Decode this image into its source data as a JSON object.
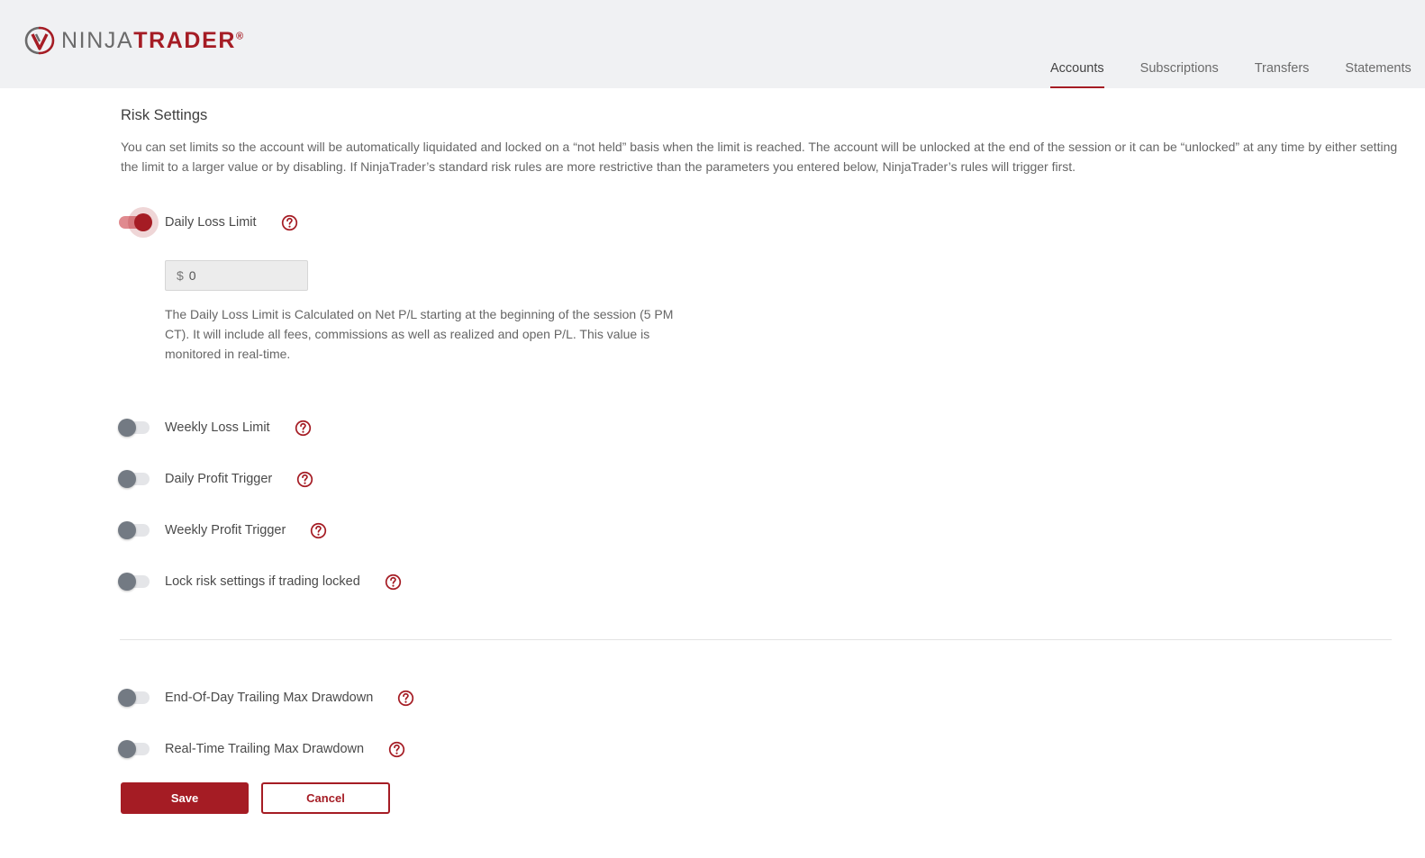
{
  "brand": {
    "ninja": "NINJA",
    "trader": "TRADER",
    "reg": "®",
    "accent": "#a51c24"
  },
  "nav": {
    "tabs": [
      {
        "label": "Accounts",
        "active": true
      },
      {
        "label": "Subscriptions"
      },
      {
        "label": "Transfers"
      },
      {
        "label": "Statements"
      }
    ]
  },
  "page": {
    "title": "Risk Settings",
    "intro": "You can set limits so the account will be automatically liquidated and locked on a “not held” basis when the limit is reached. The account will be unlocked at the end of the session or it can be “unlocked” at any time by either setting the limit to a larger value or by disabling. If NinjaTrader’s standard risk rules are more restrictive than the parameters you entered below, NinjaTrader’s rules will trigger first."
  },
  "settings": {
    "daily_loss": {
      "label": "Daily Loss Limit",
      "enabled": true,
      "currency": "$",
      "value": "0",
      "description": "The Daily Loss Limit is Calculated on Net P/L starting at the beginning of the session (5 PM CT). It will include all fees, commissions as well as realized and open P/L. This value is monitored in real-time."
    },
    "weekly_loss": {
      "label": "Weekly Loss Limit",
      "enabled": false
    },
    "daily_profit": {
      "label": "Daily Profit Trigger",
      "enabled": false
    },
    "weekly_profit": {
      "label": "Weekly Profit Trigger",
      "enabled": false
    },
    "lock_risk": {
      "label": "Lock risk settings if trading locked",
      "enabled": false
    },
    "eod_trailing": {
      "label": "End-Of-Day Trailing Max Drawdown",
      "enabled": false
    },
    "rt_trailing": {
      "label": "Real-Time Trailing Max Drawdown",
      "enabled": false
    }
  },
  "actions": {
    "save": "Save",
    "cancel": "Cancel"
  },
  "icons": {
    "help": "question-circle-icon",
    "logo": "ninjatrader-logo-icon"
  }
}
